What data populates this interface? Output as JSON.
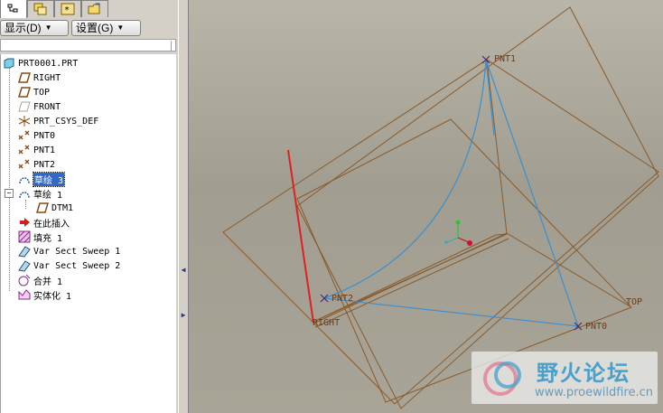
{
  "tabs": [
    {
      "icon": "model-tree-icon"
    },
    {
      "icon": "layers-icon"
    },
    {
      "icon": "star-folder-icon"
    },
    {
      "icon": "folder-browser-icon"
    }
  ],
  "toolbar": {
    "show_label": "显示(D)",
    "settings_label": "设置(G)"
  },
  "tree": {
    "root": "PRT0001.PRT",
    "items": [
      {
        "label": "RIGHT",
        "icon": "datum-plane-icon"
      },
      {
        "label": "TOP",
        "icon": "datum-plane-icon"
      },
      {
        "label": "FRONT",
        "icon": "datum-plane-hidden-icon"
      },
      {
        "label": "PRT_CSYS_DEF",
        "icon": "csys-icon"
      },
      {
        "label": "PNT0",
        "icon": "datum-point-icon"
      },
      {
        "label": "PNT1",
        "icon": "datum-point-icon"
      },
      {
        "label": "PNT2",
        "icon": "datum-point-icon"
      },
      {
        "label": "草绘 3",
        "icon": "sketch-icon",
        "selected": true
      },
      {
        "label": "草绘 1",
        "icon": "sketch-icon",
        "expanded": true
      },
      {
        "label": "DTM1",
        "icon": "datum-plane-icon",
        "child": true
      },
      {
        "label": "在此插入",
        "icon": "insert-here-icon"
      },
      {
        "label": "填充 1",
        "icon": "fill-icon"
      },
      {
        "label": "Var Sect Sweep 1",
        "icon": "vss-icon"
      },
      {
        "label": "Var Sect Sweep 2",
        "icon": "vss-icon"
      },
      {
        "label": "合并 1",
        "icon": "merge-icon"
      },
      {
        "label": "实体化 1",
        "icon": "solidify-icon"
      }
    ]
  },
  "viewport": {
    "labels": {
      "pnt1": "PNT1",
      "pnt2": "PNT2",
      "pnt0": "PNT0",
      "right": "RIGHT",
      "top": "TOP"
    },
    "colors": {
      "datum_plane": "#8a5a2a",
      "curve": "#3a8fd0",
      "highlight": "#e02020",
      "point_marker": "#4a2a6a"
    }
  },
  "watermark": {
    "title": "野火论坛",
    "url": "www.proewildfire.cn"
  }
}
